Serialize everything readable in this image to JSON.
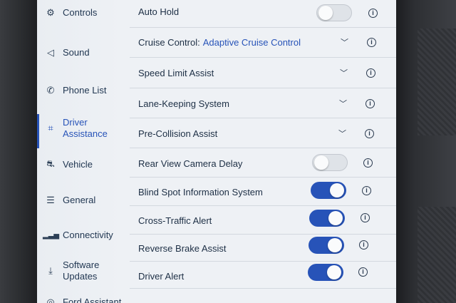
{
  "sidebar": {
    "items": [
      {
        "label": "Controls",
        "icon": "controls-icon",
        "active": false
      },
      {
        "label": "Sound",
        "icon": "speaker-icon",
        "active": false
      },
      {
        "label": "Phone List",
        "icon": "phone-icon",
        "active": false
      },
      {
        "label": "Driver\nAssistance",
        "icon": "driver-assist-icon",
        "active": true
      },
      {
        "label": "Vehicle",
        "icon": "vehicle-icon",
        "active": false
      },
      {
        "label": "General",
        "icon": "sliders-icon",
        "active": false
      },
      {
        "label": "Connectivity",
        "icon": "signal-icon",
        "active": false
      },
      {
        "label": "Software\nUpdates",
        "icon": "download-icon",
        "active": false
      },
      {
        "label": "Ford Assistant",
        "icon": "assistant-icon",
        "active": false
      }
    ]
  },
  "settings": [
    {
      "label": "Auto Hold",
      "control": "toggle",
      "on": false
    },
    {
      "label": "Cruise Control:",
      "value": "Adaptive Cruise Control",
      "control": "dropdown"
    },
    {
      "label": "Speed Limit Assist",
      "control": "dropdown"
    },
    {
      "label": "Lane-Keeping System",
      "control": "dropdown"
    },
    {
      "label": "Pre-Collision Assist",
      "control": "dropdown"
    },
    {
      "label": "Rear View Camera Delay",
      "control": "toggle",
      "on": false
    },
    {
      "label": "Blind Spot Information System",
      "control": "toggle",
      "on": true
    },
    {
      "label": "Cross-Traffic Alert",
      "control": "toggle",
      "on": true
    },
    {
      "label": "Reverse Brake Assist",
      "control": "toggle",
      "on": true
    },
    {
      "label": "Driver Alert",
      "control": "toggle",
      "on": true
    }
  ],
  "colors": {
    "accent": "#2753b8",
    "background": "#eef1f5",
    "text": "#1d2f45"
  }
}
